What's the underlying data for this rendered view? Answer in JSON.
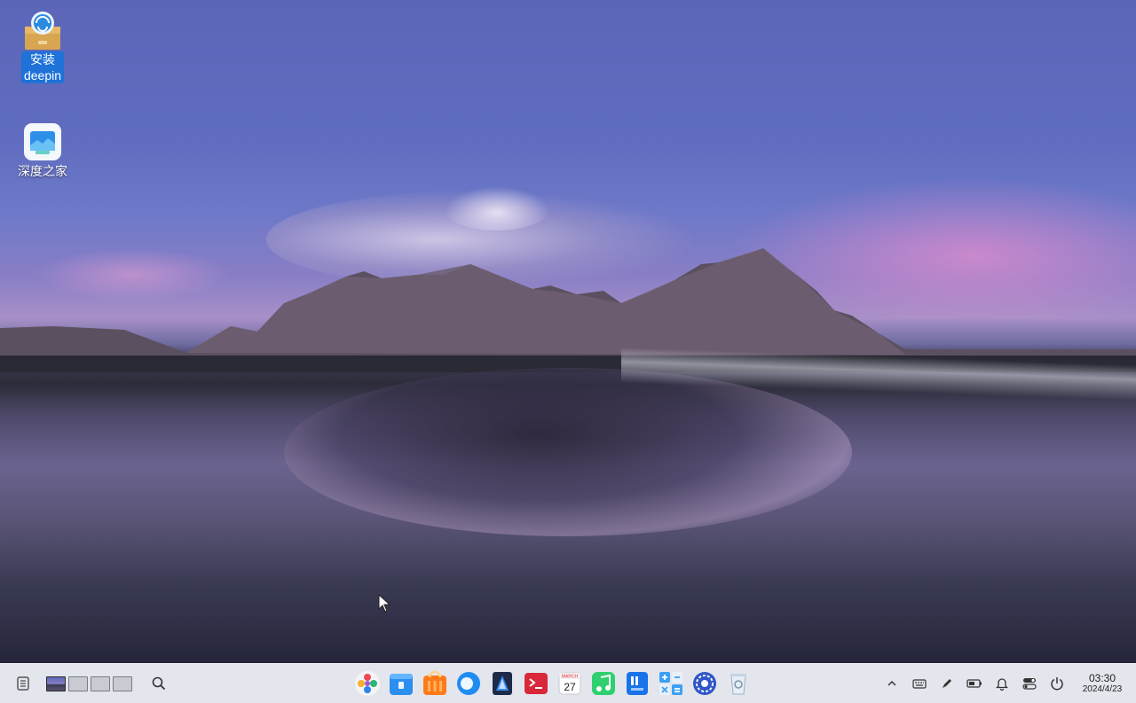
{
  "desktop": {
    "icons": [
      {
        "line1": "安装",
        "line2": "deepin",
        "icon": "installer-package-icon",
        "selected": true
      },
      {
        "line1": "深度之家",
        "icon": "deepin-home-icon",
        "selected": false
      }
    ]
  },
  "taskbar": {
    "left": {
      "show_desktop_icon": "show-desktop-icon",
      "workspace_count": 4,
      "active_workspace": 1,
      "search_icon": "search-icon"
    },
    "dock_apps": [
      {
        "name": "launcher",
        "icon": "launcher-icon"
      },
      {
        "name": "file-manager",
        "icon": "file-manager-icon"
      },
      {
        "name": "app-store",
        "icon": "app-store-icon"
      },
      {
        "name": "browser",
        "icon": "browser-icon"
      },
      {
        "name": "text-editor",
        "icon": "text-editor-icon"
      },
      {
        "name": "terminal",
        "icon": "terminal-icon"
      },
      {
        "name": "calendar",
        "icon": "calendar-icon",
        "badge_text": "27"
      },
      {
        "name": "music",
        "icon": "music-icon"
      },
      {
        "name": "document-viewer",
        "icon": "document-viewer-icon"
      },
      {
        "name": "calculator",
        "icon": "calculator-icon"
      },
      {
        "name": "control-center",
        "icon": "control-center-icon"
      },
      {
        "name": "trash",
        "icon": "trash-icon"
      }
    ],
    "tray": {
      "icons": [
        "expand-tray-icon",
        "keyboard-icon",
        "pen-icon",
        "battery-icon",
        "notification-bell-icon",
        "toggle-panel-icon",
        "power-icon"
      ],
      "time": "03:30",
      "date": "2024/4/23"
    }
  },
  "colors": {
    "selection": "#1e72d8",
    "taskbar_bg": "#e2e4ec"
  }
}
